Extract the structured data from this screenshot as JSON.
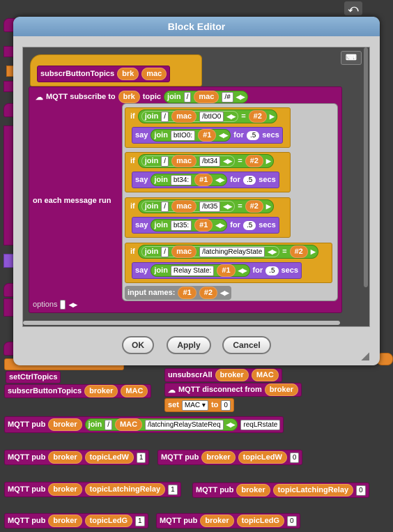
{
  "dialog": {
    "title": "Block Editor",
    "ok_label": "OK",
    "apply_label": "Apply",
    "cancel_label": "Cancel"
  },
  "definition": {
    "name": "subscrButtonTopics",
    "params": [
      "brk",
      "mac"
    ]
  },
  "subscribe": {
    "label": "MQTT subscribe to",
    "broker": "brk",
    "topic_label": "topic",
    "join": "join",
    "sep": "/",
    "mac": "mac",
    "suffix": "/#",
    "on_message": "on each message run",
    "options_label": "options",
    "input_names_label": "input names:",
    "arg1": "#1",
    "arg2": "#2"
  },
  "ifs": [
    {
      "topic": "/btIO0",
      "say_text": "btIO0:"
    },
    {
      "topic": "/bt34",
      "say_text": "bt34:"
    },
    {
      "topic": "/bt35",
      "say_text": "bt35:"
    },
    {
      "topic": "/latchingRelayState",
      "say_text": "Relay State: "
    }
  ],
  "common": {
    "if": "if",
    "eq": "=",
    "say": "say",
    "for": "for",
    "secs": "secs",
    "secs_value": ".5",
    "join": "join",
    "sep": "/",
    "mac": "mac",
    "arg1": "#1",
    "arg2": "#2"
  },
  "background": {
    "setCtrlTopics": "setCtrlTopics",
    "subscr_name": "subscrButtonTopics",
    "broker": "broker",
    "mac_caps": "MAC",
    "unsubscribe_all": "unsubscrAll",
    "disconnect": "MQTT disconnect from",
    "set_label": "set",
    "to_label": "to",
    "set_value": "0",
    "pub_label": "MQTT pub",
    "join": "join",
    "sep": "/",
    "req_topic": "/latchingRelayStateReq",
    "req_payload": "reqLRstate",
    "pubs": [
      {
        "topic": "topicLedW",
        "value": "1"
      },
      {
        "topic": "topicLedW",
        "value": "0"
      },
      {
        "topic": "topicLatchingRelay",
        "value": "1"
      },
      {
        "topic": "topicLatchingRelay",
        "value": "0"
      },
      {
        "topic": "topicLedG",
        "value": "1"
      },
      {
        "topic": "topicLedG",
        "value": "0"
      }
    ]
  }
}
